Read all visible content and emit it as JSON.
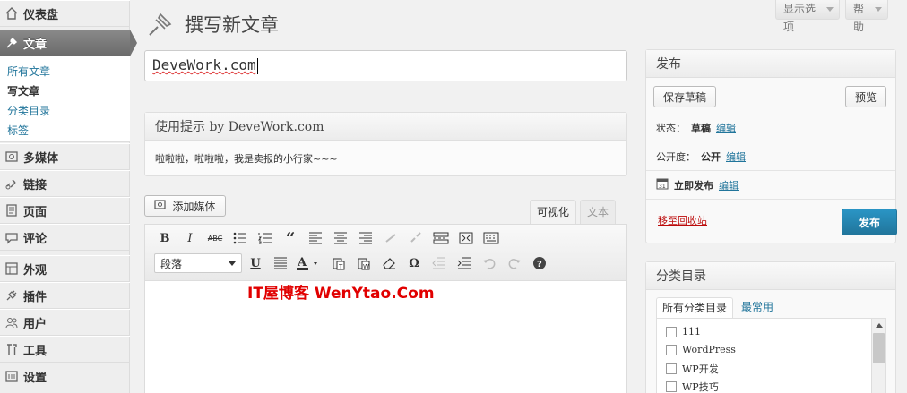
{
  "sidebar": {
    "items": [
      {
        "label": "仪表盘",
        "icon": "dashboard-icon"
      },
      {
        "label": "文章",
        "icon": "pin-icon"
      },
      {
        "label": "多媒体",
        "icon": "media-icon"
      },
      {
        "label": "链接",
        "icon": "link-icon"
      },
      {
        "label": "页面",
        "icon": "page-icon"
      },
      {
        "label": "评论",
        "icon": "comment-icon"
      },
      {
        "label": "外观",
        "icon": "appearance-icon"
      },
      {
        "label": "插件",
        "icon": "plugin-icon"
      },
      {
        "label": "用户",
        "icon": "users-icon"
      },
      {
        "label": "工具",
        "icon": "tools-icon"
      },
      {
        "label": "设置",
        "icon": "settings-icon"
      }
    ],
    "submenu": [
      "所有文章",
      "写文章",
      "分类目录",
      "标签"
    ]
  },
  "header": {
    "title": "撰写新文章",
    "screen_options": "显示选项",
    "help": "帮助"
  },
  "post_title": "DeveWork.com",
  "tips": {
    "title": "使用提示 by DeveWork.com",
    "body": "啦啦啦，啦啦啦，我是卖报的小行家~~~"
  },
  "editor": {
    "add_media": "添加媒体",
    "tab_visual": "可视化",
    "tab_text": "文本",
    "format": "段落",
    "watermark": "IT屋博客 WenYtao.Com"
  },
  "publish": {
    "title": "发布",
    "save_draft": "保存草稿",
    "preview": "预览",
    "status_label": "状态：",
    "status_value": "草稿",
    "visibility_label": "公开度：",
    "visibility_value": "公开",
    "schedule_label": "立即发布",
    "edit": "编辑",
    "trash": "移至回收站",
    "publish": "发布"
  },
  "categories": {
    "title": "分类目录",
    "tab_all": "所有分类目录",
    "tab_popular": "最常用",
    "items": [
      "111",
      "WordPress",
      "WP开发",
      "WP技巧"
    ]
  },
  "colors": {
    "accent": "#21759b",
    "trash": "#bc0b0b",
    "watermark": "#e10000"
  }
}
